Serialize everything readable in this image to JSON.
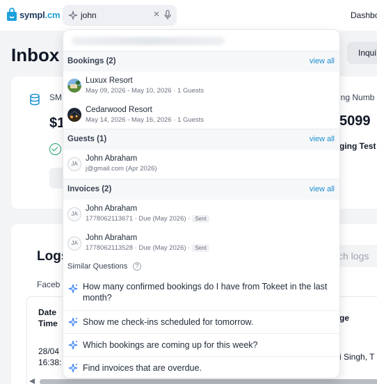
{
  "topbar": {
    "logo": {
      "name": "sympl",
      "suffix": ".cm"
    },
    "search": {
      "value": "john",
      "placeholder": ""
    },
    "nav_label": "Dashbo"
  },
  "page": {
    "title": "Inbox",
    "inquiry_button": "Inqui",
    "card": {
      "left_label": "SM",
      "left_amount": "$1",
      "right_label": "ing Numb",
      "right_amount": "5099",
      "right_text": "ging Test"
    },
    "logs": {
      "title": "Logs",
      "search_placeholder": "ch logs",
      "tab": "Faceb",
      "col_date": [
        "Date",
        "Time"
      ],
      "col_right": "ge",
      "row_date": [
        "28/04",
        "16:38:"
      ],
      "row_right": "i Singh, T"
    }
  },
  "dropdown": {
    "bookings": {
      "title": "Bookings (2)",
      "view_all": "view all",
      "items": [
        {
          "title": "Luxux Resort",
          "subtitle": "May 09, 2026 - May 10, 2026 · 1 Guests"
        },
        {
          "title": "Cedarwood Resort",
          "subtitle": "May 14, 2026 - May 16, 2026 · 1 Guests"
        }
      ]
    },
    "guests": {
      "title": "Guests (1)",
      "view_all": "view all",
      "items": [
        {
          "initials": "JA",
          "title": "John Abraham",
          "subtitle": "j@gmail.com (Apr 2026)"
        }
      ]
    },
    "invoices": {
      "title": "Invoices (2)",
      "view_all": "view all",
      "items": [
        {
          "initials": "JA",
          "title": "John Abraham",
          "subtitle": "1778062113671 · Due (May 2026) ·",
          "badge": "Sent"
        },
        {
          "initials": "JA",
          "title": "John Abraham",
          "subtitle": "1778062113528 · Due (May 2026) ·",
          "badge": "Sent"
        }
      ]
    },
    "similar": {
      "title": "Similar Questions",
      "help": "?",
      "questions": [
        "How many confirmed bookings do I have from Tokeet in the last month?",
        "Show me check-ins scheduled for tomorrow.",
        "Which bookings are coming up for this week?",
        "Find invoices that are overdue."
      ]
    }
  },
  "colors": {
    "accent": "#1a8fd1",
    "logo_blue": "#1ca0dc",
    "sparkle": "#3b82f6"
  },
  "icons": [
    "logo-bag-icon",
    "sparkle-icon",
    "close-icon",
    "mic-icon",
    "database-icon",
    "check-circle-icon",
    "help-icon"
  ]
}
